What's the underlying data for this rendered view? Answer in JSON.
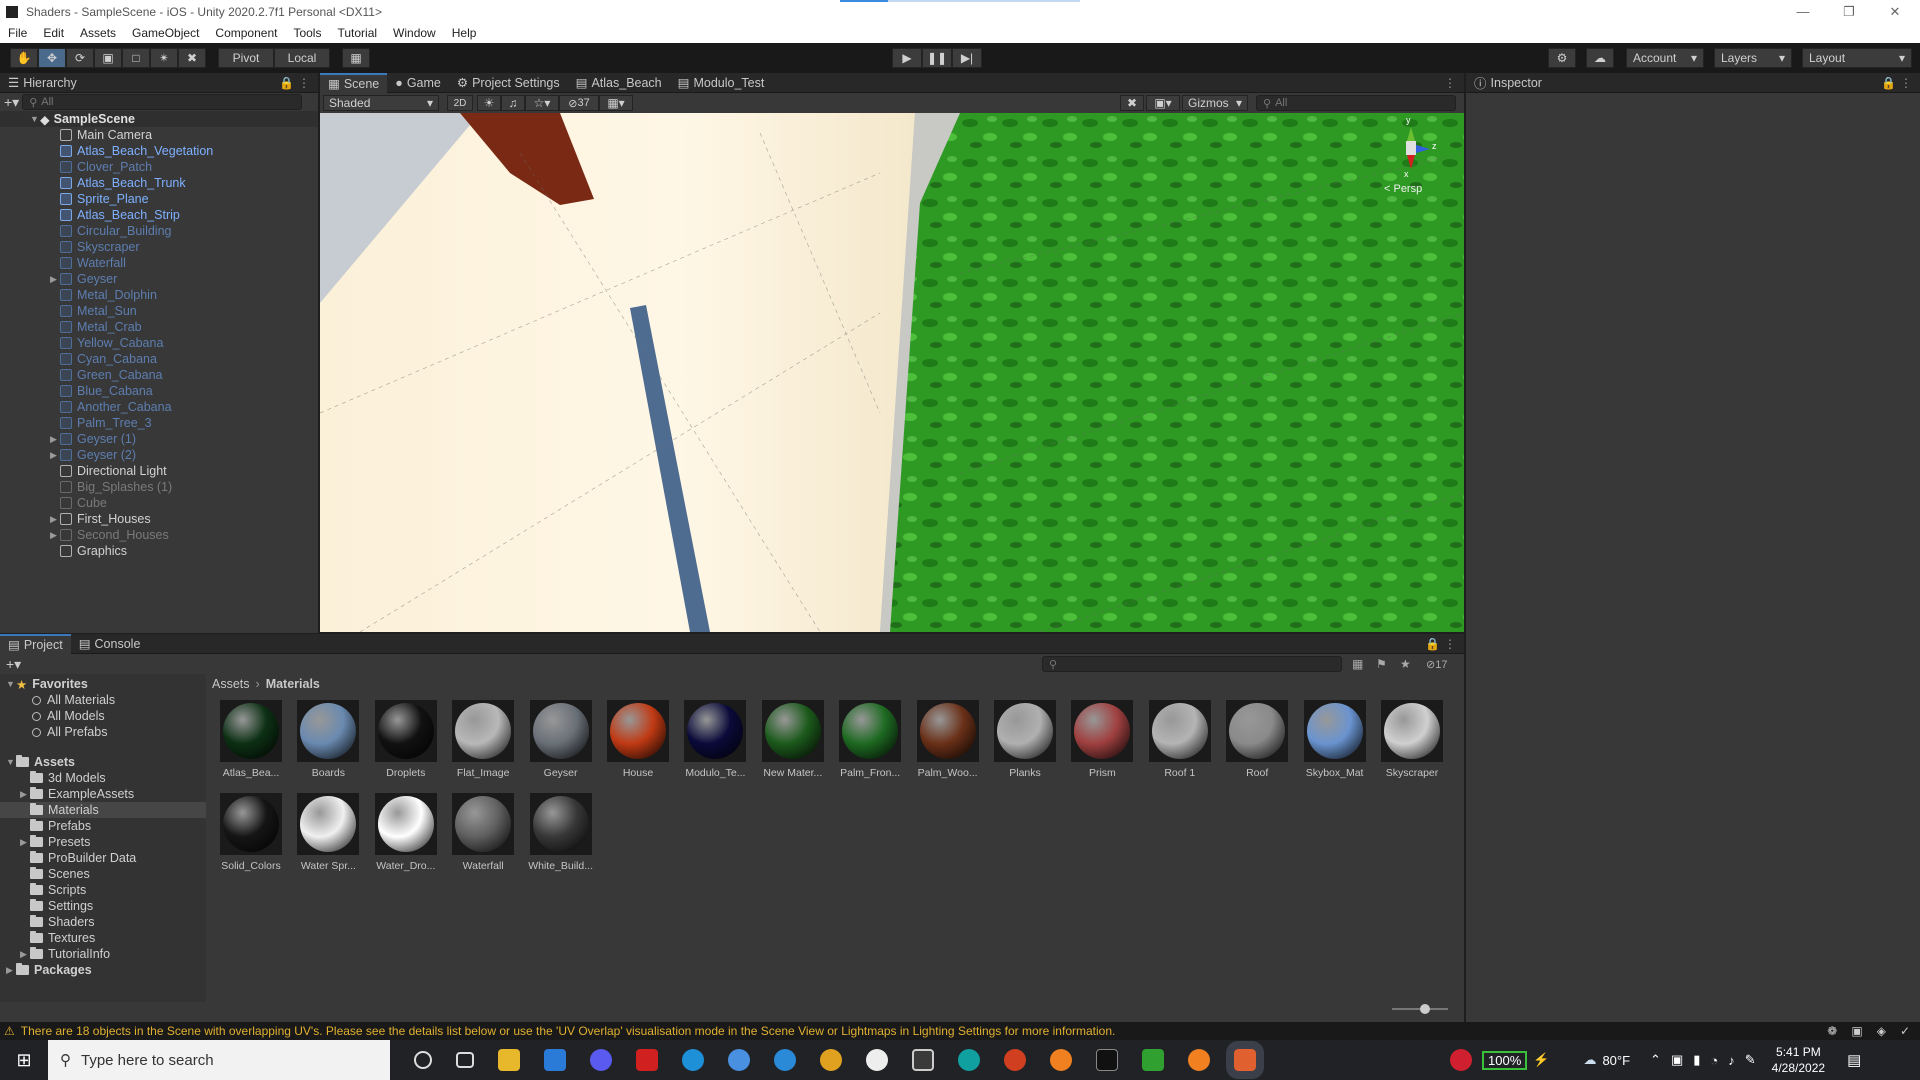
{
  "window": {
    "title": "Shaders - SampleScene - iOS - Unity 2020.2.7f1 Personal <DX11>"
  },
  "menu": [
    "File",
    "Edit",
    "Assets",
    "GameObject",
    "Component",
    "Tools",
    "Tutorial",
    "Window",
    "Help"
  ],
  "toolbar": {
    "pivot": "Pivot",
    "local": "Local",
    "account": "Account",
    "layers": "Layers",
    "layout": "Layout"
  },
  "hierarchy": {
    "tab": "Hierarchy",
    "search_placeholder": "All",
    "scene": "SampleScene",
    "items": [
      {
        "name": "Main Camera",
        "style": "normal",
        "arrow": false
      },
      {
        "name": "Atlas_Beach_Vegetation",
        "style": "prefab",
        "arrow": false
      },
      {
        "name": "Clover_Patch",
        "style": "dimprefab",
        "arrow": false
      },
      {
        "name": "Atlas_Beach_Trunk",
        "style": "prefab",
        "arrow": false
      },
      {
        "name": "Sprite_Plane",
        "style": "prefab",
        "arrow": false
      },
      {
        "name": "Atlas_Beach_Strip",
        "style": "prefab",
        "arrow": false
      },
      {
        "name": "Circular_Building",
        "style": "dimprefab",
        "arrow": false
      },
      {
        "name": "Skyscraper",
        "style": "dimprefab",
        "arrow": false
      },
      {
        "name": "Waterfall",
        "style": "dimprefab",
        "arrow": false
      },
      {
        "name": "Geyser",
        "style": "dimprefab",
        "arrow": true
      },
      {
        "name": "Metal_Dolphin",
        "style": "dimprefab",
        "arrow": false
      },
      {
        "name": "Metal_Sun",
        "style": "dimprefab",
        "arrow": false
      },
      {
        "name": "Metal_Crab",
        "style": "dimprefab",
        "arrow": false
      },
      {
        "name": "Yellow_Cabana",
        "style": "dimprefab",
        "arrow": false
      },
      {
        "name": "Cyan_Cabana",
        "style": "dimprefab",
        "arrow": false
      },
      {
        "name": "Green_Cabana",
        "style": "dimprefab",
        "arrow": false
      },
      {
        "name": "Blue_Cabana",
        "style": "dimprefab",
        "arrow": false
      },
      {
        "name": "Another_Cabana",
        "style": "dimprefab",
        "arrow": false
      },
      {
        "name": "Palm_Tree_3",
        "style": "dimprefab",
        "arrow": false
      },
      {
        "name": "Geyser (1)",
        "style": "dimprefab",
        "arrow": true
      },
      {
        "name": "Geyser (2)",
        "style": "dimprefab",
        "arrow": true
      },
      {
        "name": "Directional Light",
        "style": "normal",
        "arrow": false
      },
      {
        "name": "Big_Splashes (1)",
        "style": "dim",
        "arrow": false
      },
      {
        "name": "Cube",
        "style": "dim",
        "arrow": false
      },
      {
        "name": "First_Houses",
        "style": "normal",
        "arrow": true
      },
      {
        "name": "Second_Houses",
        "style": "dim",
        "arrow": true
      },
      {
        "name": "Graphics",
        "style": "normal",
        "arrow": false
      }
    ]
  },
  "scene_tabs": [
    "Scene",
    "Game",
    "Project Settings",
    "Atlas_Beach",
    "Modulo_Test"
  ],
  "scene_toolbar": {
    "shading": "Shaded",
    "mode2d": "2D",
    "hidden_count": "37",
    "gizmos": "Gizmos",
    "search_placeholder": "All",
    "persp": "< Persp",
    "axis_y": "y",
    "axis_x": "x",
    "axis_z": "z"
  },
  "inspector": {
    "tab": "Inspector"
  },
  "project": {
    "tabs": [
      "Project",
      "Console"
    ],
    "breadcrumb": [
      "Assets",
      "Materials"
    ],
    "count": "17",
    "favorites": {
      "label": "Favorites",
      "items": [
        "All Materials",
        "All Models",
        "All Prefabs"
      ]
    },
    "assets": {
      "label": "Assets",
      "items": [
        {
          "name": "3d Models",
          "arrow": false
        },
        {
          "name": "ExampleAssets",
          "arrow": true
        },
        {
          "name": "Materials",
          "arrow": false,
          "selected": true
        },
        {
          "name": "Prefabs",
          "arrow": false
        },
        {
          "name": "Presets",
          "arrow": true
        },
        {
          "name": "ProBuilder Data",
          "arrow": false
        },
        {
          "name": "Scenes",
          "arrow": false
        },
        {
          "name": "Scripts",
          "arrow": false
        },
        {
          "name": "Settings",
          "arrow": false
        },
        {
          "name": "Shaders",
          "arrow": false
        },
        {
          "name": "Textures",
          "arrow": false
        },
        {
          "name": "TutorialInfo",
          "arrow": true
        }
      ]
    },
    "packages": "Packages",
    "materials": [
      {
        "label": "Atlas_Bea...",
        "color": "#0c3014"
      },
      {
        "label": "Boards",
        "color": "#6a8ab0"
      },
      {
        "label": "Droplets",
        "color": "#111111"
      },
      {
        "label": "Flat_Image",
        "color": "#b8b8b8"
      },
      {
        "label": "Geyser",
        "color": "#6a7078"
      },
      {
        "label": "House",
        "color": "#c03a14"
      },
      {
        "label": "Modulo_Te...",
        "color": "#0a0a3a"
      },
      {
        "label": "New Mater...",
        "color": "#1c5a1c"
      },
      {
        "label": "Palm_Fron...",
        "color": "#1e6a22"
      },
      {
        "label": "Palm_Woo...",
        "color": "#6a3018"
      },
      {
        "label": "Planks",
        "color": "#b0b0b0"
      },
      {
        "label": "Prism",
        "color": "#a04040"
      },
      {
        "label": "Roof 1",
        "color": "#b4b4b4"
      },
      {
        "label": "Roof",
        "color": "#8a8a8a"
      },
      {
        "label": "Skybox_Mat",
        "color": "#6a94d0"
      },
      {
        "label": "Skyscraper",
        "color": "#d0d0d0"
      },
      {
        "label": "Solid_Colors",
        "color": "#151515"
      },
      {
        "label": "Water Spr...",
        "color": "#f0f0f0"
      },
      {
        "label": "Water_Dro...",
        "color": "#ffffff"
      },
      {
        "label": "Waterfall",
        "color": "#606060"
      },
      {
        "label": "White_Build...",
        "color": "#383838"
      }
    ]
  },
  "status": {
    "message": "There are 18 objects in the Scene with overlapping UV's. Please see the details list below or use the 'UV Overlap' visualisation mode in the Scene View or Lightmaps in Lighting Settings for more information."
  },
  "taskbar": {
    "search_placeholder": "Type here to search",
    "battery": "100%",
    "weather": "80°F",
    "time": "5:41 PM",
    "date": "4/28/2022"
  }
}
